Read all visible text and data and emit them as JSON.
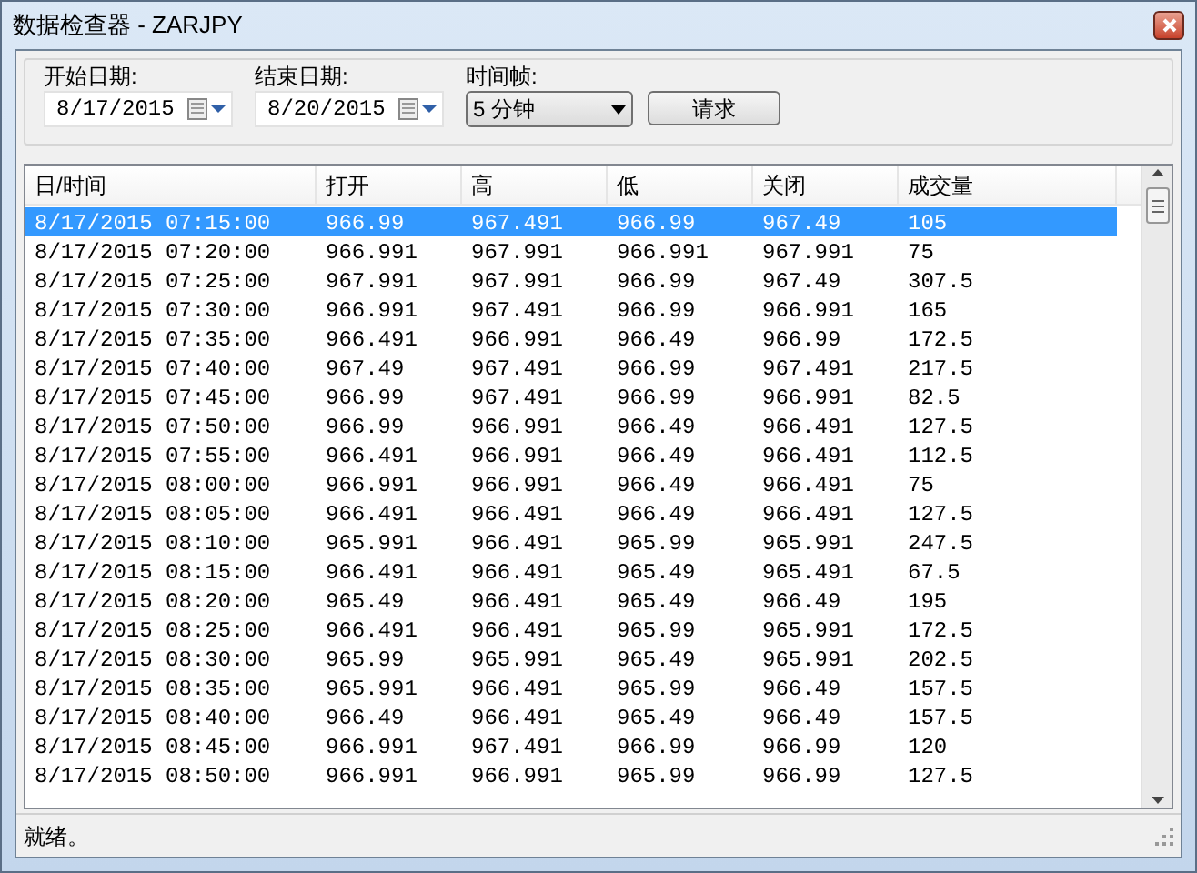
{
  "window": {
    "title": "数据检查器 -  ZARJPY"
  },
  "filters": {
    "start_label": "开始日期:",
    "start_value": "8/17/2015",
    "end_label": "结束日期:",
    "end_value": "8/20/2015",
    "timeframe_label": "时间帧:",
    "timeframe_value": "5 分钟",
    "request_button": "请求"
  },
  "table": {
    "columns": [
      "日/时间",
      "打开",
      "高",
      "低",
      "关闭",
      "成交量"
    ],
    "rows": [
      {
        "selected": true,
        "cells": [
          "8/17/2015 07:15:00",
          "966.99",
          "967.491",
          "966.99",
          "967.49",
          "105"
        ]
      },
      {
        "selected": false,
        "cells": [
          "8/17/2015 07:20:00",
          "966.991",
          "967.991",
          "966.991",
          "967.991",
          "75"
        ]
      },
      {
        "selected": false,
        "cells": [
          "8/17/2015 07:25:00",
          "967.991",
          "967.991",
          "966.99",
          "967.49",
          "307.5"
        ]
      },
      {
        "selected": false,
        "cells": [
          "8/17/2015 07:30:00",
          "966.991",
          "967.491",
          "966.99",
          "966.991",
          "165"
        ]
      },
      {
        "selected": false,
        "cells": [
          "8/17/2015 07:35:00",
          "966.491",
          "966.991",
          "966.49",
          "966.99",
          "172.5"
        ]
      },
      {
        "selected": false,
        "cells": [
          "8/17/2015 07:40:00",
          "967.49",
          "967.491",
          "966.99",
          "967.491",
          "217.5"
        ]
      },
      {
        "selected": false,
        "cells": [
          "8/17/2015 07:45:00",
          "966.99",
          "967.491",
          "966.99",
          "966.991",
          "82.5"
        ]
      },
      {
        "selected": false,
        "cells": [
          "8/17/2015 07:50:00",
          "966.99",
          "966.991",
          "966.49",
          "966.491",
          "127.5"
        ]
      },
      {
        "selected": false,
        "cells": [
          "8/17/2015 07:55:00",
          "966.491",
          "966.991",
          "966.49",
          "966.491",
          "112.5"
        ]
      },
      {
        "selected": false,
        "cells": [
          "8/17/2015 08:00:00",
          "966.991",
          "966.991",
          "966.49",
          "966.491",
          "75"
        ]
      },
      {
        "selected": false,
        "cells": [
          "8/17/2015 08:05:00",
          "966.491",
          "966.491",
          "966.49",
          "966.491",
          "127.5"
        ]
      },
      {
        "selected": false,
        "cells": [
          "8/17/2015 08:10:00",
          "965.991",
          "966.491",
          "965.99",
          "965.991",
          "247.5"
        ]
      },
      {
        "selected": false,
        "cells": [
          "8/17/2015 08:15:00",
          "966.491",
          "966.491",
          "965.49",
          "965.491",
          "67.5"
        ]
      },
      {
        "selected": false,
        "cells": [
          "8/17/2015 08:20:00",
          "965.49",
          "966.491",
          "965.49",
          "966.49",
          "195"
        ]
      },
      {
        "selected": false,
        "cells": [
          "8/17/2015 08:25:00",
          "966.491",
          "966.491",
          "965.99",
          "965.991",
          "172.5"
        ]
      },
      {
        "selected": false,
        "cells": [
          "8/17/2015 08:30:00",
          "965.99",
          "965.991",
          "965.49",
          "965.991",
          "202.5"
        ]
      },
      {
        "selected": false,
        "cells": [
          "8/17/2015 08:35:00",
          "965.991",
          "966.491",
          "965.99",
          "966.49",
          "157.5"
        ]
      },
      {
        "selected": false,
        "cells": [
          "8/17/2015 08:40:00",
          "966.49",
          "966.491",
          "965.49",
          "966.49",
          "157.5"
        ]
      },
      {
        "selected": false,
        "cells": [
          "8/17/2015 08:45:00",
          "966.991",
          "967.491",
          "966.99",
          "966.99",
          "120"
        ]
      },
      {
        "selected": false,
        "cells": [
          "8/17/2015 08:50:00",
          "966.991",
          "966.991",
          "965.99",
          "966.99",
          "127.5"
        ]
      }
    ]
  },
  "status_bar": {
    "text": "就绪。"
  }
}
